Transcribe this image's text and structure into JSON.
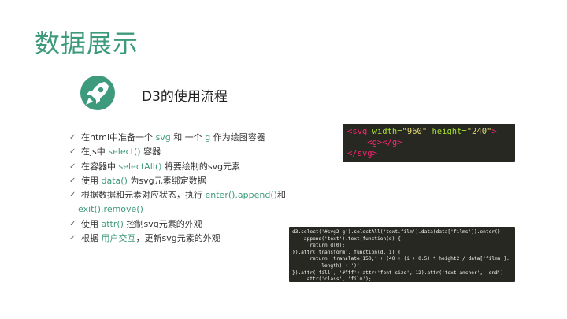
{
  "slide": {
    "title": "数据展示",
    "subtitle": "D3的使用流程",
    "icon": "rocket-icon",
    "accent_color": "#3e9a7c"
  },
  "steps": [
    {
      "pre": "在html中准备一个 ",
      "h1": "svg",
      "mid": " 和 一个 ",
      "h2": "g",
      "post": " 作为绘图容器"
    },
    {
      "pre": "在js中 ",
      "h1": "select()",
      "mid": " 容器",
      "h2": "",
      "post": ""
    },
    {
      "pre": "在容器中 ",
      "h1": "selectAll()",
      "mid": " 将要绘制的svg元素",
      "h2": "",
      "post": ""
    },
    {
      "pre": "使用 ",
      "h1": "data()",
      "mid": " 为svg元素绑定数据",
      "h2": "",
      "post": ""
    },
    {
      "pre": "根据数据和元素对应状态，执行 ",
      "h1": "enter().append()",
      "mid": "和",
      "h2": "",
      "post": ""
    },
    {
      "pre": "exit().remove()",
      "h1": "",
      "mid": "",
      "h2": "",
      "post": ""
    },
    {
      "pre": "使用 ",
      "h1": "attr()",
      "mid": " 控制svg元素的外观",
      "h2": "",
      "post": ""
    },
    {
      "pre": "根据 ",
      "h1": "用户交互",
      "mid": "，更新svg元素的外观",
      "h2": "",
      "post": ""
    }
  ],
  "check_mark": "✓",
  "code1": {
    "l1_open": "<svg ",
    "l1_attr1": "width=",
    "l1_val1": "\"960\"",
    "l1_attr2": " height=",
    "l1_val2": "\"240\"",
    "l1_close": ">",
    "l2": "    <g></g>",
    "l3": "</svg>"
  },
  "code2": {
    "lines": [
      "d3.select('#svg2 g').selectAll('text.film').data(data['films']).enter().",
      "    append('text').text(function(d) {",
      "      return d[0];",
      "}).attr('transform', function(d, i) {",
      "      return 'translate(150,' + (40 + (i + 0.5) * height2 / data['films'].",
      "          length) + ')';",
      "}).attr('fill', '#fff').attr('font-size', 12).attr('text-anchor', 'end')",
      "    .attr('class', 'film');"
    ]
  }
}
